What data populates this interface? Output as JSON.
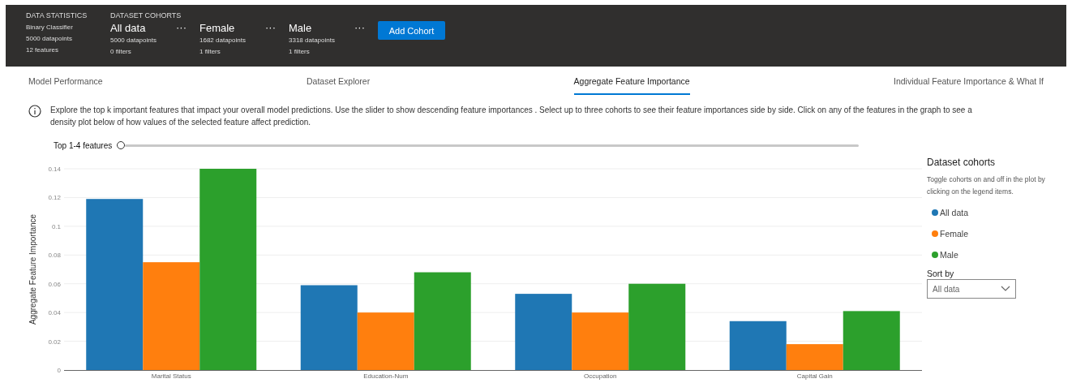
{
  "header": {
    "stats_title": "DATA STATISTICS",
    "stats": [
      "Binary Classifier",
      "5000 datapoints",
      "12 features"
    ],
    "cohorts_title": "DATASET COHORTS",
    "more_glyph": "···",
    "cohorts": [
      {
        "name": "All data",
        "datapoints": "5000 datapoints",
        "filters": "0 filters"
      },
      {
        "name": "Female",
        "datapoints": "1682 datapoints",
        "filters": "1 filters"
      },
      {
        "name": "Male",
        "datapoints": "3318 datapoints",
        "filters": "1 filters"
      }
    ],
    "add_button": "Add Cohort"
  },
  "tabs": [
    {
      "label": "Model Performance",
      "selected": false
    },
    {
      "label": "Dataset Explorer",
      "selected": false
    },
    {
      "label": "Aggregate Feature Importance",
      "selected": true
    },
    {
      "label": "Individual Feature Importance & What If",
      "selected": false
    }
  ],
  "info_text": "Explore the top k important features that impact your overall model predictions. Use the slider to show descending feature importances . Select up to three cohorts to see their feature importances side by side. Click on any of the features in the graph to see a density plot below of how values of the selected feature affect prediction.",
  "slider": {
    "label": "Top 1-4 features",
    "level": 0
  },
  "chart": {
    "chart_data": {
      "type": "bar",
      "ylabel": "Aggregate Feature Importance",
      "categories": [
        "Marital Status",
        "Education-Num",
        "Occupation",
        "Capital Gain"
      ],
      "series": [
        {
          "name": "All data",
          "color": "#1f77b4",
          "values": [
            0.119,
            0.059,
            0.053,
            0.034
          ]
        },
        {
          "name": "Female",
          "color": "#ff7f0e",
          "values": [
            0.075,
            0.04,
            0.04,
            0.018
          ]
        },
        {
          "name": "Male",
          "color": "#2ca02c",
          "values": [
            0.14,
            0.068,
            0.06,
            0.041
          ]
        }
      ],
      "ylim": [
        0,
        0.14
      ],
      "grid": true,
      "yticks": [
        0,
        {
          "value": 0.02,
          "label": "0.02"
        },
        {
          "value": 0.04,
          "label": "0.04"
        },
        {
          "value": 0.06,
          "label": "0.06"
        },
        {
          "value": 0.08,
          "label": "0.08"
        },
        {
          "value": 0.1,
          "label": "0.1"
        },
        {
          "value": 0.12,
          "label": "0.12"
        },
        {
          "value": 0.14,
          "label": "0.14"
        }
      ]
    }
  },
  "legend": {
    "title": "Dataset cohorts",
    "hint": "Toggle cohorts on and off in the plot by clicking on the legend items.",
    "sort_label": "Sort by",
    "sort_value": "All data"
  }
}
